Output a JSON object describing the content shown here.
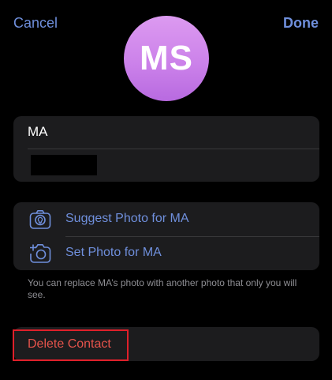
{
  "nav": {
    "cancel_label": "Cancel",
    "done_label": "Done"
  },
  "avatar": {
    "initials": "MS"
  },
  "name_fields": {
    "first_value": "MA",
    "second_value": ""
  },
  "photo_options": {
    "suggest_label": "Suggest Photo for MA",
    "set_label": "Set Photo for MA",
    "suggest_icon": "suggest-photo-icon",
    "set_icon": "camera-plus-icon"
  },
  "footnote": "You can replace MA’s photo with another photo that only you will see.",
  "delete": {
    "label": "Delete Contact"
  },
  "colors": {
    "accent": "#6f8fdc",
    "destructive": "#e5534b",
    "highlight_box": "#e0202a",
    "avatar_gradient_top": "#dc9af0",
    "avatar_gradient_bottom": "#b86ae0"
  }
}
